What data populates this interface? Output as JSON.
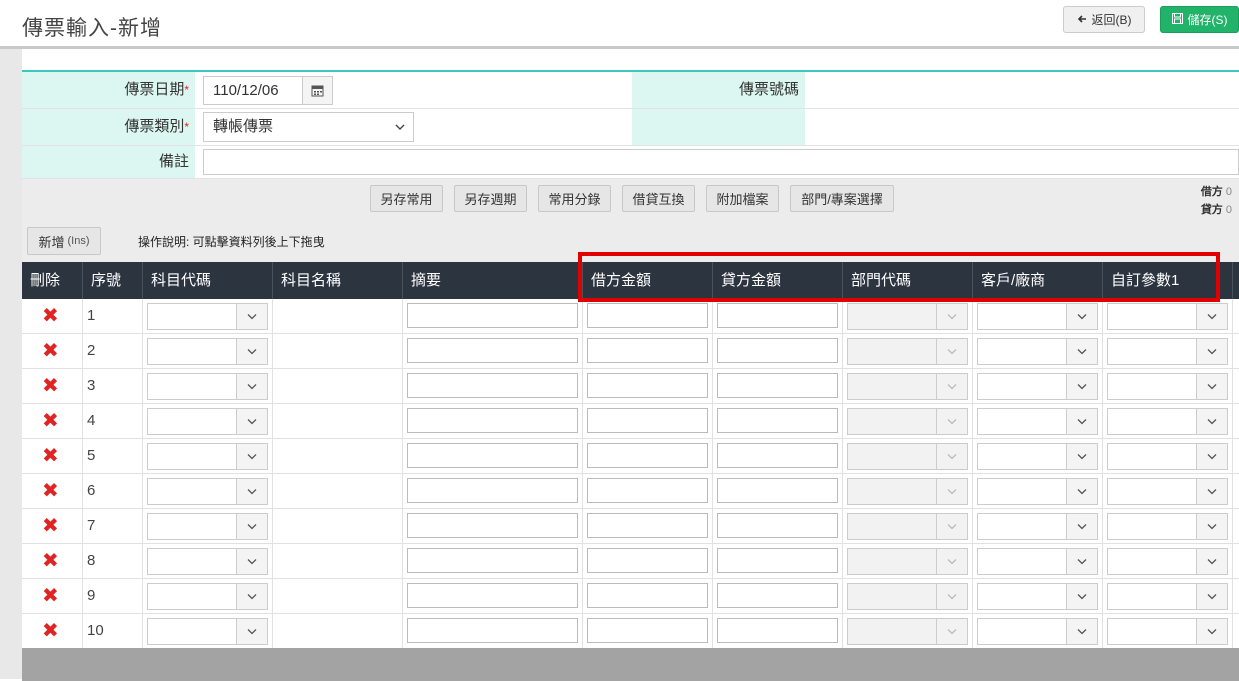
{
  "header": {
    "title": "傳票輸入-新增",
    "back_label": "返回(B)",
    "save_label": "儲存(S)"
  },
  "form": {
    "date_label": "傳票日期",
    "date_value": "110/12/06",
    "voucher_no_label": "傳票號碼",
    "type_label": "傳票類別",
    "type_value": "轉帳傳票",
    "note_label": "備註",
    "required_mark": "*"
  },
  "toolbar": {
    "buttons": [
      "另存常用",
      "另存週期",
      "常用分錄",
      "借貸互換",
      "附加檔案",
      "部門/專案選擇"
    ],
    "debit_label": "借方",
    "debit_value": "0",
    "credit_label": "貸方",
    "credit_value": "0"
  },
  "add_button": {
    "label": "新增",
    "shortcut": "(Ins)"
  },
  "hint": "操作說明: 可點擊資料列後上下拖曳",
  "grid": {
    "columns": [
      "刪除",
      "序號",
      "科目代碼",
      "科目名稱",
      "摘要",
      "借方金額",
      "貸方金額",
      "部門代碼",
      "客戶/廠商",
      "自訂參數1"
    ],
    "rows": [
      "1",
      "2",
      "3",
      "4",
      "5",
      "6",
      "7",
      "8",
      "9",
      "10"
    ]
  },
  "colors": {
    "accent": "#3cc6bd",
    "label_bg": "#dcf7f1",
    "header_bg": "#2c3440",
    "save_green": "#21b36a",
    "delete_red": "#e02424",
    "highlight_box": "#e00000"
  }
}
